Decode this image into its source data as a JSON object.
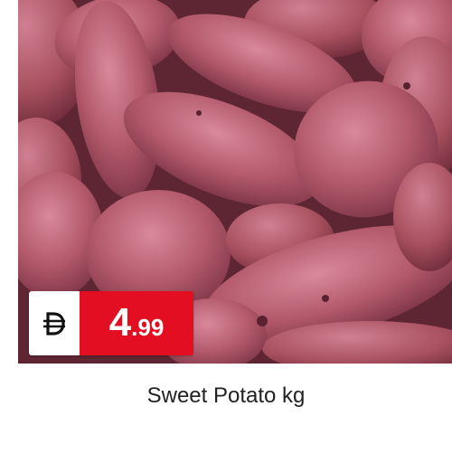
{
  "product": {
    "name": "Sweet Potato kg",
    "image_subject": "sweet-potatoes-photo"
  },
  "price": {
    "currency_icon": "dirham-icon",
    "integer": "4",
    "decimal": ".99"
  },
  "colors": {
    "badge_red": "#e30e21",
    "potato_skin": "#b55a6e",
    "text": "#222222"
  }
}
